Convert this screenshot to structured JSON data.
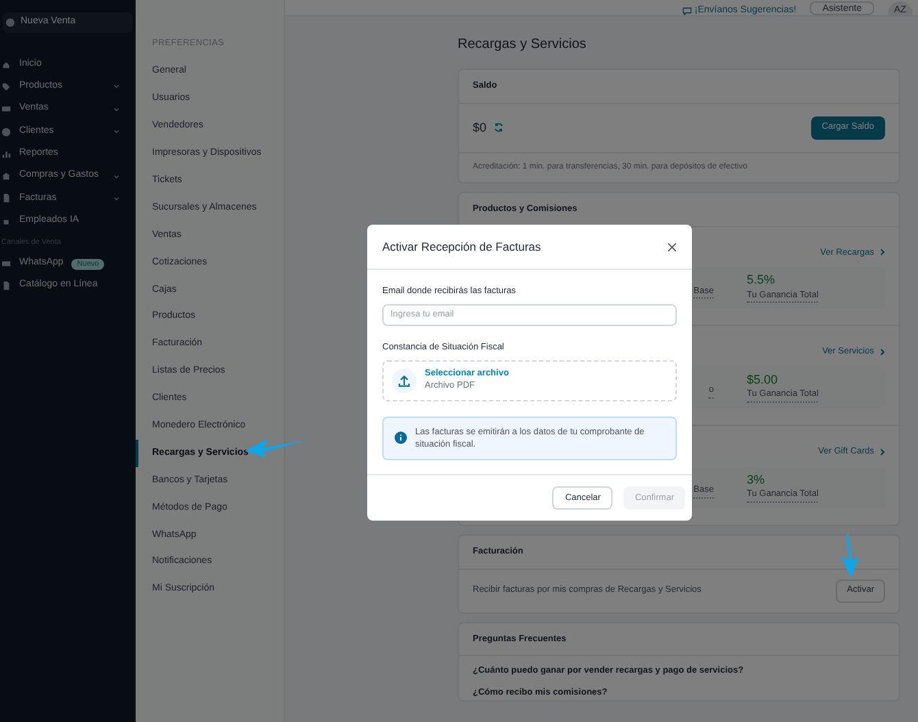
{
  "header": {
    "feedback_link": "¡Envíanos Sugerencias!",
    "assistant_button": "Asistente",
    "avatar": "AZ"
  },
  "sidebar": {
    "new_sale": "Nueva Venta",
    "items": [
      {
        "label": "Inicio",
        "expandable": false
      },
      {
        "label": "Productos",
        "expandable": true
      },
      {
        "label": "Ventas",
        "expandable": true
      },
      {
        "label": "Clientes",
        "expandable": true
      },
      {
        "label": "Reportes",
        "expandable": false
      },
      {
        "label": "Compras y Gastos",
        "expandable": true
      },
      {
        "label": "Facturas",
        "expandable": true
      },
      {
        "label": "Empleados IA",
        "expandable": false
      }
    ],
    "section_label": "Canales de Venta",
    "channels": [
      {
        "label": "WhatsApp",
        "badge": "Nuevo"
      },
      {
        "label": "Catálogo en Línea"
      }
    ]
  },
  "settings_nav": {
    "heading": "PREFERENCIAS",
    "items": [
      {
        "label": "General",
        "selected": false
      },
      {
        "label": "Usuarios",
        "selected": false
      },
      {
        "label": "Vendedores",
        "selected": false
      },
      {
        "label": "Impresoras y Dispositivos",
        "selected": false
      },
      {
        "label": "Tickets",
        "selected": false
      },
      {
        "label": "Sucursales y Almacenes",
        "selected": false
      },
      {
        "label": "Ventas",
        "selected": false
      },
      {
        "label": "Cotizaciones",
        "selected": false
      },
      {
        "label": "Cajas",
        "selected": false
      },
      {
        "label": "Productos",
        "selected": false
      },
      {
        "label": "Facturación",
        "selected": false
      },
      {
        "label": "Listas de Precios",
        "selected": false
      },
      {
        "label": "Clientes",
        "selected": false
      },
      {
        "label": "Monedero Electrónico",
        "selected": false
      },
      {
        "label": "Recargas y Servicios",
        "selected": true
      },
      {
        "label": "Bancos y Tarjetas",
        "selected": false
      },
      {
        "label": "Métodos de Pago",
        "selected": false
      },
      {
        "label": "WhatsApp",
        "selected": false
      },
      {
        "label": "Notificaciones",
        "selected": false
      },
      {
        "label": "Mi Suscripción",
        "selected": false
      }
    ]
  },
  "main": {
    "title": "Recargas y Servicios",
    "balance_card": {
      "title": "Saldo",
      "amount": "$0",
      "button": "Cargar Saldo",
      "note": "Acreditación: 1 min. para transferencias, 30 min. para depósitos de efectivo"
    },
    "products_card": {
      "title": "Productos y Comisiones",
      "sections": [
        {
          "link": "Ver Recargas",
          "column_1": "Base",
          "value": "5.5%",
          "value_label": "Tu Ganancia Total"
        },
        {
          "link": "Ver Servicios",
          "column_1": "o",
          "value": "$5.00",
          "value_label": "Tu Ganancia Total"
        },
        {
          "link": "Ver Gift Cards",
          "column_1": "Base",
          "value": "3%",
          "value_label": "Tu Ganancia Total"
        }
      ]
    },
    "billing_card": {
      "title": "Facturación",
      "text": "Recibir facturas por mis compras de Recargas y Servicios",
      "button": "Activar"
    },
    "faq_card": {
      "title": "Preguntas Frecuentes",
      "questions": [
        "¿Cuánto puedo ganar por vender recargas y pago de servicios?",
        "¿Cómo recibo mis comisiones?"
      ]
    }
  },
  "modal": {
    "title": "Activar Recepción de Facturas",
    "email_label": "Email donde recibirás las facturas",
    "email_placeholder": "Ingresa tu email",
    "file_label": "Constancia de Situación Fiscal",
    "file_link": "Seleccionar archivo",
    "file_hint": "Archivo PDF",
    "info": "Las facturas se emitirán a los datos de tu comprobante de situación fiscal.",
    "cancel": "Cancelar",
    "confirm": "Confirmar",
    "confirm_disabled": true
  }
}
